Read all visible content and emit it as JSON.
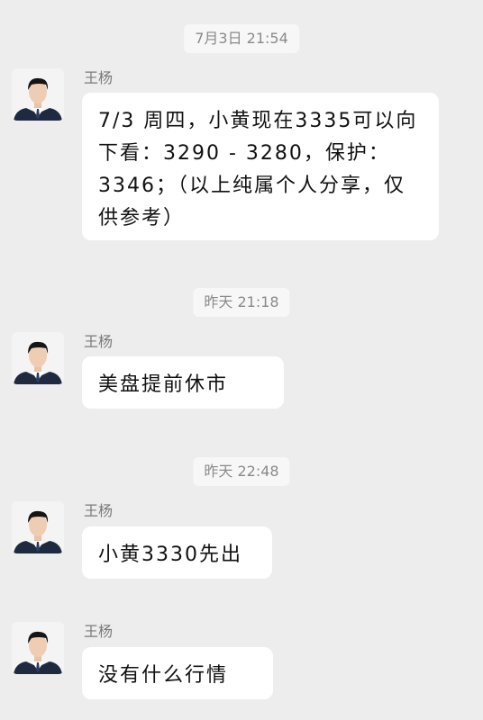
{
  "messages": [
    {
      "timestamp": "7月3日 21:54",
      "sender": "王杨",
      "text": "7/3 周四，小黄现在3335可以向下看：3290 - 3280，保护：3346；（以上纯属个人分享，仅供参考）"
    },
    {
      "timestamp": "昨天 21:18",
      "sender": "王杨",
      "text": "美盘提前休市"
    },
    {
      "timestamp": "昨天 22:48",
      "sender": "王杨",
      "text": "小黄3330先出"
    },
    {
      "sender": "王杨",
      "text": "没有什么行情"
    }
  ],
  "colors": {
    "background": "#ededed",
    "bubble": "#ffffff",
    "timestamp_bg": "#f7f7f7",
    "timestamp_text": "#8a8a8a",
    "sender_text": "#7a7a7a"
  }
}
